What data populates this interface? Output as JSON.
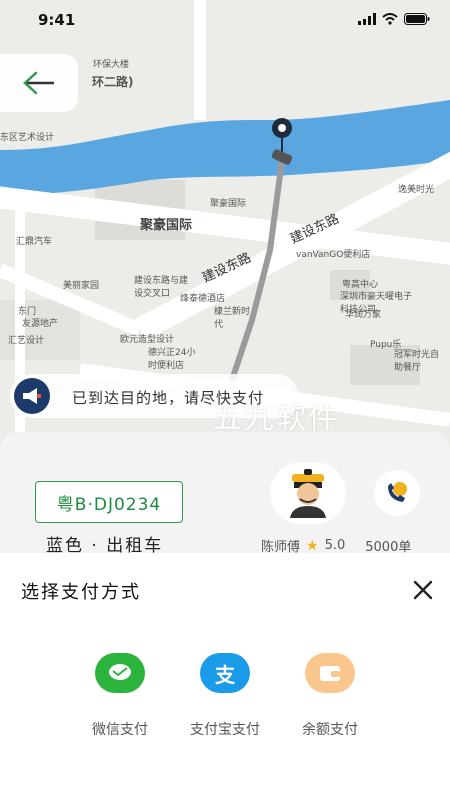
{
  "status_bar": {
    "time": "9:41"
  },
  "map": {
    "labels": {
      "road_partial": "环二路)",
      "huanbao": "环保大楼",
      "juhao": "聚豪国际",
      "juhao_small": "聚豪国际",
      "jianshe_east_1": "建设东路",
      "jianshe_east_2": "建设东路",
      "huiying": "汇鼎汽车",
      "meilanjiayuan": "美丽家园",
      "jianshe_crossing": "建设东路与建设交叉口",
      "fengtai": "烽泰德酒店",
      "vanvango": "vanVanGO便利店",
      "yuegao": "粤高中心",
      "shenzhen_store": "深圳市豪天曜电子科技公司",
      "huarun": "华润万家",
      "pupu": "Pupu乐",
      "dongmen": "东门",
      "youyuan": "友源地产",
      "ouyuan": "欧元造型设计",
      "lianyuan": "德兴正24小时便利店",
      "dijiang": "棣兰新时代",
      "zhizuo": "冠军时光自助餐厅",
      "shenzhen_partial": "逸美时光",
      "east_design": "东区艺术设计",
      "huiyi": "汇艺设计"
    }
  },
  "notice": {
    "text": "已到达目的地，请尽快支付"
  },
  "watermark": "五九软件",
  "driver_card": {
    "plate": "粤B·DJ0234",
    "car_desc": "蓝色 · 出租车",
    "driver_name": "陈师傅",
    "rating": "5.0",
    "orders": "5000单"
  },
  "payment_sheet": {
    "title": "选择支付方式",
    "options": [
      {
        "label": "微信支付",
        "icon": "wechat-pay-icon",
        "color": "#2db43c"
      },
      {
        "label": "支付宝支付",
        "icon": "alipay-icon",
        "color": "#1a9bea"
      },
      {
        "label": "余额支付",
        "icon": "wallet-icon",
        "color": "#f9c78d"
      }
    ]
  },
  "colors": {
    "river": "#5aa6e0",
    "plate_green": "#2e9a4b",
    "back_arrow": "#2e9a4b"
  }
}
